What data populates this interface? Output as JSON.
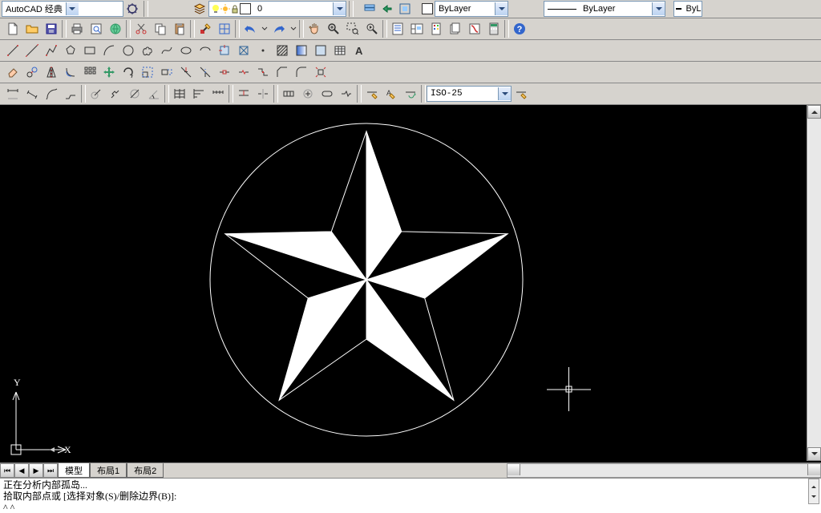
{
  "top": {
    "workspace": "AutoCAD 经典",
    "layer_state": "0",
    "bylayer1": "ByLayer",
    "bylayer2": "ByLayer",
    "bylayer3": "ByL"
  },
  "dim_style": "ISO-25",
  "tabs": {
    "model": "模型",
    "layout1": "布局1",
    "layout2": "布局2"
  },
  "command": {
    "line1": "正在分析内部孤岛...",
    "line2": "拾取内部点或 [选择对象(S)/删除边界(B)]:"
  },
  "axis": {
    "x": "X",
    "y": "Y"
  },
  "icons": {
    "new": "new-file",
    "open": "open",
    "save": "save",
    "print": "print",
    "plot": "plot-preview",
    "cut": "cut",
    "copy": "copy",
    "paste": "paste",
    "match": "match-prop",
    "undo": "undo",
    "redo": "redo",
    "pan": "pan",
    "zoom": "zoom",
    "zoomwin": "zoom-window",
    "props": "properties",
    "dcenter": "design-center",
    "toolpal": "tool-palettes",
    "sheet": "sheet-set",
    "markup": "markup",
    "calc": "quickcalc",
    "help": "help",
    "line": "line",
    "cline": "construction-line",
    "pline": "polyline",
    "polygon": "polygon",
    "rect": "rectangle",
    "arc": "arc",
    "circle": "circle",
    "revcloud": "revision-cloud",
    "spline": "spline",
    "ellipse": "ellipse",
    "ellarc": "ellipse-arc",
    "block": "insert-block",
    "mkblock": "make-block",
    "point": "point",
    "hatch": "hatch",
    "grad": "gradient",
    "region": "region",
    "table": "table",
    "mtext": "multiline-text",
    "mirror": "mirror",
    "offset": "offset",
    "array": "array",
    "move": "move",
    "rotate": "rotate",
    "scale": "scale",
    "stretch": "stretch",
    "trim": "trim",
    "extend": "extend",
    "break": "break-at-point",
    "break2": "break",
    "join": "join",
    "chamfer": "chamfer",
    "fillet": "fillet",
    "explode": "explode",
    "dimlin": "dim-linear",
    "dimalg": "dim-aligned",
    "dimarc": "dim-arc",
    "dimord": "dim-ordinate",
    "dimrad": "dim-radius",
    "dimjog": "dim-jogged",
    "dimdia": "dim-diameter",
    "dimang": "dim-angular",
    "dimqck": "quick-dim",
    "dimbas": "dim-baseline",
    "dimcnt": "dim-continue",
    "dimspc": "dim-space",
    "dimbrk": "dim-break",
    "tol": "tolerance",
    "ctrmrk": "center-mark",
    "insp": "inspection",
    "dimjln": "dim-jog-line",
    "dimed": "dim-edit",
    "dimted": "dim-text-edit",
    "dimupd": "dim-update"
  }
}
